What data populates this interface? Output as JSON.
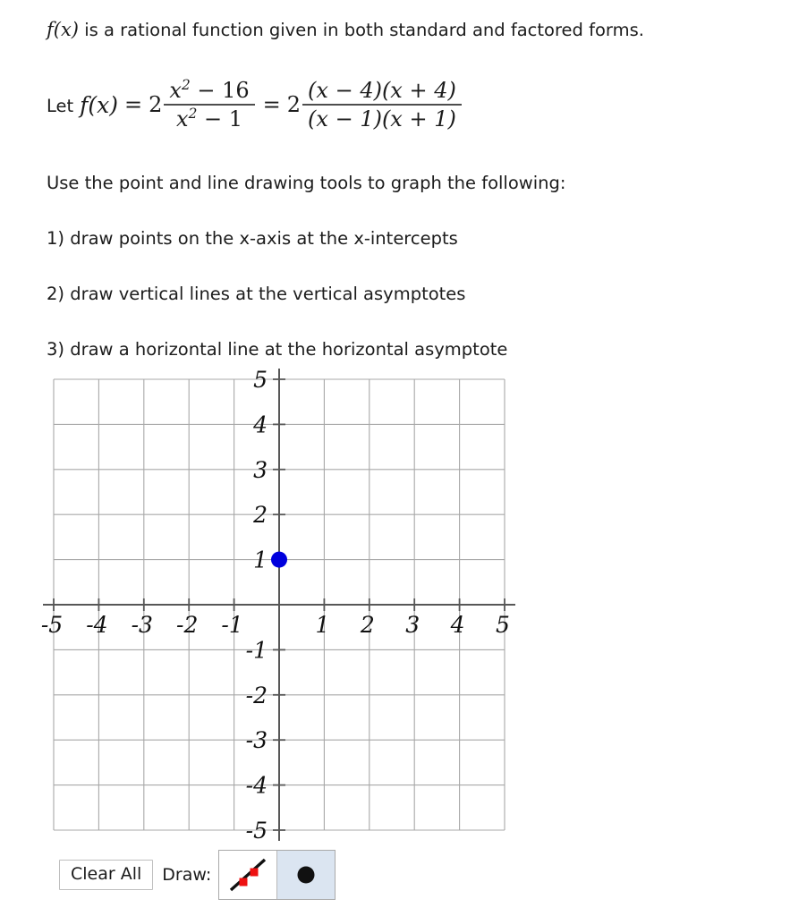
{
  "problem": {
    "intro_math": "f(x)",
    "intro_text": " is a rational function given in both standard and factored forms.",
    "equation": {
      "lead_label": "Let",
      "function_name": "f(x)",
      "equals_1": "=",
      "coefficient_1": "2",
      "fraction_1": {
        "numerator": "x² − 16",
        "numerator_base": "x",
        "numerator_exp": "2",
        "numerator_rest": " − 16",
        "denominator_base": "x",
        "denominator_exp": "2",
        "denominator_rest": " − 1"
      },
      "equals_2": "=",
      "coefficient_2": "2",
      "fraction_2": {
        "numerator": "(x − 4)(x + 4)",
        "denominator": "(x − 1)(x + 1)"
      }
    },
    "directions": "Use the point and line drawing tools to graph the following:",
    "tasks": [
      "1) draw points on the x-axis at the x-intercepts",
      "2) draw vertical lines at the vertical asymptotes",
      "3) draw a horizontal line at the horizontal asymptote"
    ]
  },
  "chart_data": {
    "type": "scatter",
    "title": "",
    "xlabel": "",
    "ylabel": "",
    "xlim": [
      -5,
      5
    ],
    "ylim": [
      -5,
      5
    ],
    "grid": true,
    "grid_step": 1,
    "legend": "none",
    "x_tick_labels": [
      "-5",
      "-4",
      "-3",
      "-2",
      "-1",
      "",
      "1",
      "2",
      "3",
      "4",
      "5"
    ],
    "y_tick_labels": [
      "5",
      "4",
      "3",
      "2",
      "1",
      "",
      "-1",
      "-2",
      "-3",
      "-4",
      "-5"
    ],
    "points": [
      {
        "x": 0,
        "y": 1,
        "color": "#0000dd",
        "radius": 9
      }
    ],
    "lines": [],
    "axis_color": "#575757",
    "grid_color": "#a8a8a8",
    "point_color": "#0000dd"
  },
  "toolbar": {
    "clear_all_label": "Clear All",
    "draw_label": "Draw:",
    "tools": [
      {
        "name": "line-tool",
        "selected": false,
        "icon": "line-with-handles-icon"
      },
      {
        "name": "point-tool",
        "selected": true,
        "icon": "filled-dot-icon"
      }
    ],
    "selected_tool": "point-tool",
    "selected_background": "#dbe5f1",
    "handle_color": "#ee1111"
  }
}
